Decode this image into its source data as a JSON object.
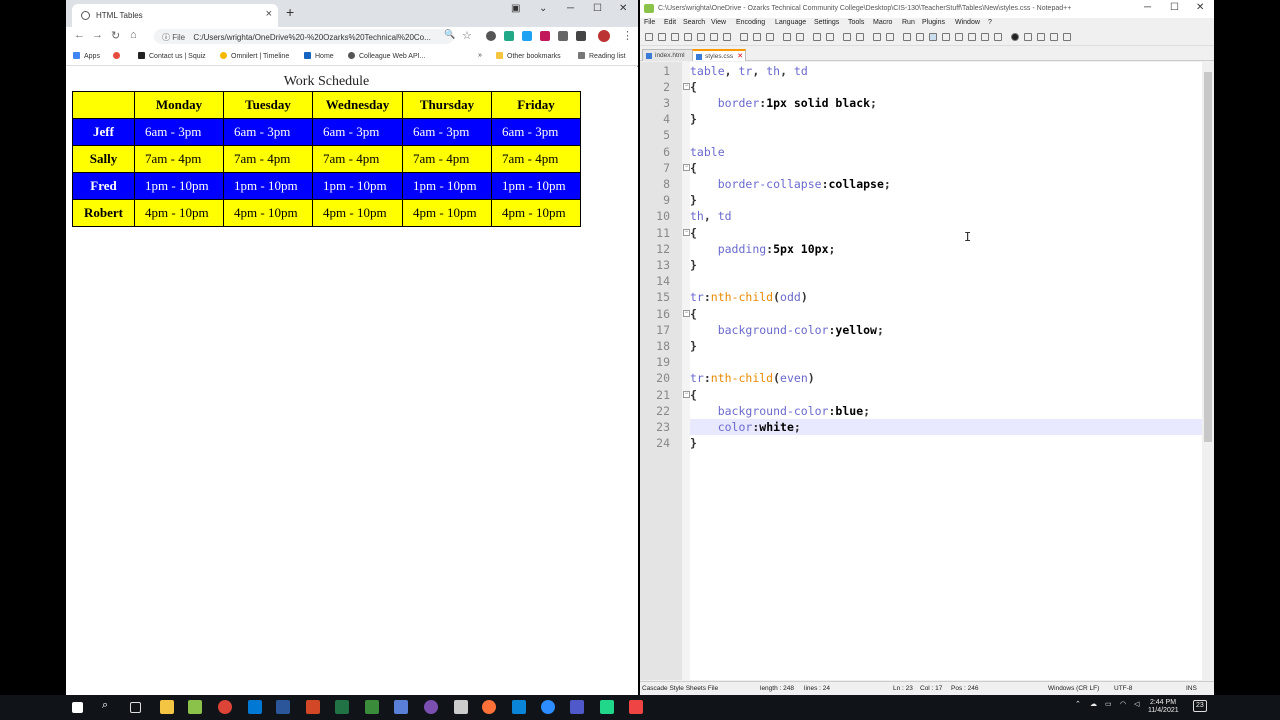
{
  "browser": {
    "tab_title": "HTML Tables",
    "url_scheme": "File",
    "url": "C:/Users/wrighta/OneDrive%20-%20Ozarks%20Technical%20Co...",
    "bookmarks": [
      "Apps",
      "Contact us | Squiz",
      "Omnilert | Timeline",
      "Home",
      "Colleague Web API...",
      "Other bookmarks",
      "Reading list"
    ]
  },
  "page": {
    "caption": "Work Schedule",
    "headers": [
      "",
      "Monday",
      "Tuesday",
      "Wednesday",
      "Thursday",
      "Friday"
    ],
    "rows": [
      {
        "name": "Jeff",
        "shifts": [
          "6am - 3pm",
          "6am - 3pm",
          "6am - 3pm",
          "6am - 3pm",
          "6am - 3pm"
        ]
      },
      {
        "name": "Sally",
        "shifts": [
          "7am - 4pm",
          "7am - 4pm",
          "7am - 4pm",
          "7am - 4pm",
          "7am - 4pm"
        ]
      },
      {
        "name": "Fred",
        "shifts": [
          "1pm - 10pm",
          "1pm - 10pm",
          "1pm - 10pm",
          "1pm - 10pm",
          "1pm - 10pm"
        ]
      },
      {
        "name": "Robert",
        "shifts": [
          "4pm - 10pm",
          "4pm - 10pm",
          "4pm - 10pm",
          "4pm - 10pm",
          "4pm - 10pm"
        ]
      }
    ]
  },
  "editor": {
    "title": "C:\\Users\\wrighta\\OneDrive - Ozarks Technical Community College\\Desktop\\CIS-130\\TeacherStuff\\Tables\\New\\styles.css - Notepad++",
    "menu": [
      "File",
      "Edit",
      "Search",
      "View",
      "Encoding",
      "Language",
      "Settings",
      "Tools",
      "Macro",
      "Run",
      "Plugins",
      "Window",
      "?"
    ],
    "tabs": [
      "index.html",
      "styles.css"
    ],
    "code_lines": [
      "table, tr, th, td",
      "{",
      "    border:1px solid black;",
      "}",
      "",
      "table",
      "{",
      "    border-collapse:collapse;",
      "}",
      "th, td",
      "{",
      "    padding:5px 10px;",
      "}",
      "",
      "tr:nth-child(odd)",
      "{",
      "    background-color:yellow;",
      "}",
      "",
      "tr:nth-child(even)",
      "{",
      "    background-color:blue;",
      "    color:white;",
      "}"
    ],
    "status": {
      "filetype": "Cascade Style Sheets File",
      "length": "length : 248",
      "lines": "lines : 24",
      "ln": "Ln : 23",
      "col": "Col : 17",
      "pos": "Pos : 246",
      "eol": "Windows (CR LF)",
      "encoding": "UTF-8",
      "mode": "INS"
    }
  },
  "taskbar": {
    "time": "2:44 PM",
    "date": "11/4/2021",
    "notifications": "23"
  },
  "colors": {
    "odd_row": "#ffff00",
    "even_row": "#0000ff",
    "even_text": "#ffffff"
  }
}
